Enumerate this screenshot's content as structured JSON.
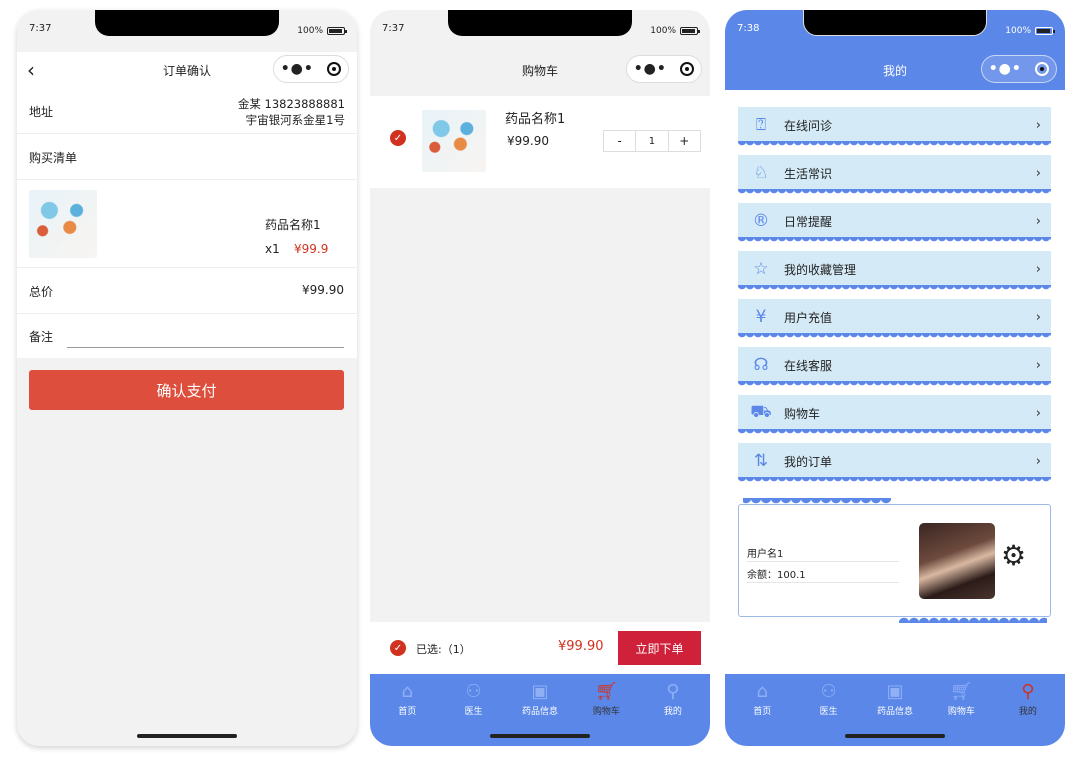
{
  "order": {
    "time": "7:37",
    "battery": "100%",
    "title": "订单确认",
    "address_label": "地址",
    "address_line1": "金某 13823888881",
    "address_line2": "宇宙银河系金星1号",
    "list_label": "购买清单",
    "product_name": "药品名称1",
    "qty": "x1",
    "price": "¥99.9",
    "total_label": "总价",
    "total_value": "¥99.90",
    "note_label": "备注",
    "confirm_label": "确认支付"
  },
  "cart": {
    "time": "7:37",
    "battery": "100%",
    "title": "购物车",
    "product_name": "药品名称1",
    "price": "¥99.90",
    "minus": "-",
    "qty": "1",
    "plus": "+",
    "selected": "已选:（1）",
    "total": "¥99.90",
    "order_btn": "立即下单"
  },
  "mine": {
    "time": "7:38",
    "battery": "100%",
    "title": "我的",
    "menu": [
      {
        "label": "在线问诊",
        "icon": "consult-icon"
      },
      {
        "label": "生活常识",
        "icon": "knowledge-icon"
      },
      {
        "label": "日常提醒",
        "icon": "reminder-icon"
      },
      {
        "label": "我的收藏管理",
        "icon": "star-icon"
      },
      {
        "label": "用户充值",
        "icon": "moneybag-icon"
      },
      {
        "label": "在线客服",
        "icon": "headset-icon"
      },
      {
        "label": "购物车",
        "icon": "cart-icon"
      },
      {
        "label": "我的订单",
        "icon": "order-icon"
      }
    ],
    "username": "用户名1",
    "balance": "余额：100.1"
  },
  "tabs": [
    "首页",
    "医生",
    "药品信息",
    "购物车",
    "我的"
  ],
  "colors": {
    "accent": "#5b87e8",
    "red": "#d0321f",
    "button": "#de4e3c"
  }
}
